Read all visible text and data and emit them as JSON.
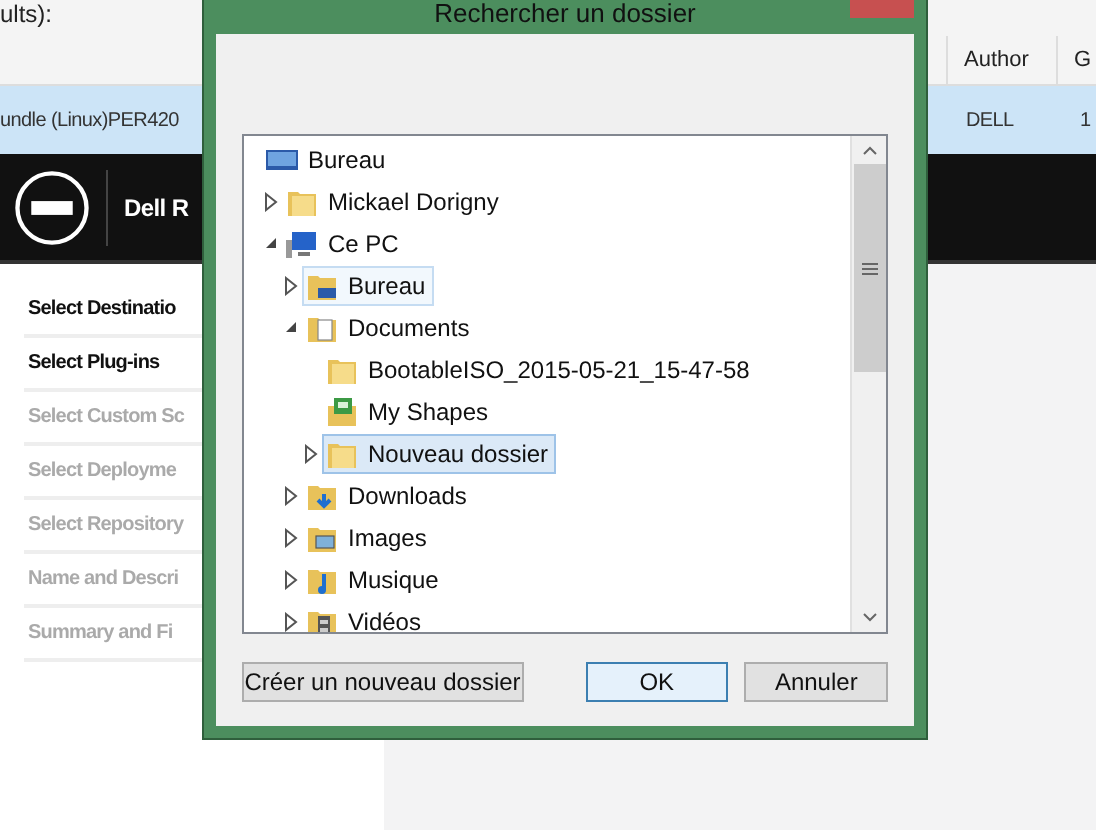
{
  "background_app": {
    "caption": "ults):",
    "table": {
      "columns": [
        "",
        "Author",
        "G"
      ],
      "rows": [
        {
          "cells": [
            "undle (Linux)PER420 ",
            "DELL",
            "1"
          ],
          "selected": true
        }
      ]
    },
    "header": {
      "title": "Dell R"
    },
    "steps": [
      {
        "label": "Select Destinatio",
        "enabled": true
      },
      {
        "label": "Select Plug-ins",
        "enabled": true
      },
      {
        "label": "Select Custom Sc",
        "enabled": false
      },
      {
        "label": "Select Deployme",
        "enabled": false
      },
      {
        "label": "Select Repository",
        "enabled": false
      },
      {
        "label": "Name and Descri",
        "enabled": false
      },
      {
        "label": "Summary and Fi",
        "enabled": false
      }
    ]
  },
  "dialog": {
    "title": "Rechercher un dossier",
    "tree": [
      {
        "label": "Bureau",
        "kind": "desktop",
        "selected": false,
        "children": [
          {
            "label": "Mickael Dorigny",
            "kind": "folder",
            "selected": false,
            "expanded": false
          },
          {
            "label": "Ce PC",
            "kind": "computer",
            "selected": false,
            "expanded": true,
            "children": [
              {
                "label": "Bureau",
                "kind": "desktop-folder",
                "selected": false,
                "hovered": true,
                "expanded": false
              },
              {
                "label": "Documents",
                "kind": "documents",
                "selected": false,
                "expanded": true,
                "children": [
                  {
                    "label": "BootableISO_2015-05-21_15-47-58",
                    "kind": "folder",
                    "selected": false
                  },
                  {
                    "label": "My Shapes",
                    "kind": "shapes",
                    "selected": false
                  },
                  {
                    "label": "Nouveau dossier",
                    "kind": "folder",
                    "selected": true,
                    "expanded": false
                  }
                ]
              },
              {
                "label": "Downloads",
                "kind": "downloads",
                "selected": false,
                "expanded": false
              },
              {
                "label": "Images",
                "kind": "images",
                "selected": false,
                "expanded": false
              },
              {
                "label": "Musique",
                "kind": "music",
                "selected": false,
                "expanded": false
              },
              {
                "label": "Vidéos",
                "kind": "videos",
                "selected": false,
                "expanded": false
              }
            ]
          }
        ]
      }
    ],
    "buttons": [
      {
        "label": "Créer un nouveau dossier",
        "default": false
      },
      {
        "label": "OK",
        "default": true
      },
      {
        "label": "Annuler",
        "default": false
      }
    ]
  }
}
